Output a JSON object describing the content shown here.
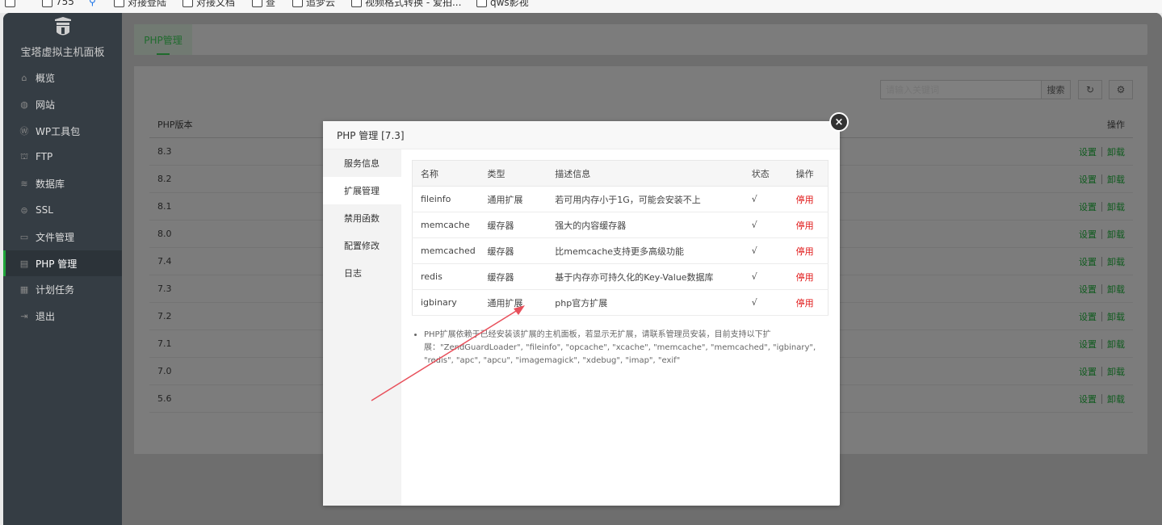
{
  "bookmarks": [
    {
      "label": "755"
    },
    {
      "label": ""
    },
    {
      "label": "对接登陆"
    },
    {
      "label": "对接文档"
    },
    {
      "label": "查"
    },
    {
      "label": "追梦云"
    },
    {
      "label": "视频格式转换 - 爱拍..."
    },
    {
      "label": "qws影视"
    }
  ],
  "sidebar": {
    "title": "宝塔虚拟主机面板",
    "items": [
      {
        "label": "概览",
        "icon": "home-icon"
      },
      {
        "label": "网站",
        "icon": "globe-icon"
      },
      {
        "label": "WP工具包",
        "icon": "wordpress-icon"
      },
      {
        "label": "FTP",
        "icon": "ftp-icon"
      },
      {
        "label": "数据库",
        "icon": "database-icon"
      },
      {
        "label": "SSL",
        "icon": "ssl-icon"
      },
      {
        "label": "文件管理",
        "icon": "folder-icon"
      },
      {
        "label": "PHP 管理",
        "icon": "php-icon"
      },
      {
        "label": "计划任务",
        "icon": "calendar-icon"
      },
      {
        "label": "退出",
        "icon": "logout-icon"
      }
    ],
    "active_index": 7
  },
  "page": {
    "tab_label": "PHP管理",
    "search_placeholder": "请输入关键词",
    "search_button": "搜索",
    "table_header_version": "PHP版本",
    "table_header_action": "操作",
    "action_settings": "设置",
    "action_uninstall": "卸载",
    "versions": [
      "8.3",
      "8.2",
      "8.1",
      "8.0",
      "7.4",
      "7.3",
      "7.2",
      "7.1",
      "7.0",
      "5.6"
    ]
  },
  "modal": {
    "title": "PHP 管理 [7.3]",
    "close_glyph": "×",
    "menu": [
      {
        "label": "服务信息"
      },
      {
        "label": "扩展管理"
      },
      {
        "label": "禁用函数"
      },
      {
        "label": "配置修改"
      },
      {
        "label": "日志"
      }
    ],
    "active_menu_index": 1,
    "table_headers": {
      "name": "名称",
      "type": "类型",
      "desc": "描述信息",
      "state": "状态",
      "action": "操作"
    },
    "extensions": [
      {
        "name": "fileinfo",
        "type": "通用扩展",
        "desc": "若可用内存小于1G，可能会安装不上",
        "state": "√",
        "action": "停用"
      },
      {
        "name": "memcache",
        "type": "缓存器",
        "desc": "强大的内容缓存器",
        "state": "√",
        "action": "停用"
      },
      {
        "name": "memcached",
        "type": "缓存器",
        "desc": "比memcache支持更多高级功能",
        "state": "√",
        "action": "停用"
      },
      {
        "name": "redis",
        "type": "缓存器",
        "desc": "基于内存亦可持久化的Key-Value数据库",
        "state": "√",
        "action": "停用"
      },
      {
        "name": "igbinary",
        "type": "通用扩展",
        "desc": "php官方扩展",
        "state": "√",
        "action": "停用"
      }
    ],
    "note": "PHP扩展依赖于已经安装该扩展的主机面板，若显示无扩展，请联系管理员安装，目前支持以下扩展：\"ZendGuardLoader\", \"fileinfo\", \"opcache\", \"xcache\", \"memcache\", \"memcached\", \"igbinary\", \"redis\", \"apc\", \"apcu\", \"imagemagick\", \"xdebug\", \"imap\", \"exif\""
  },
  "colors": {
    "accent_green": "#20a53a",
    "stop_red": "#e01616",
    "sidebar_bg": "#353d44",
    "annotation_arrow": "#e8505b"
  }
}
